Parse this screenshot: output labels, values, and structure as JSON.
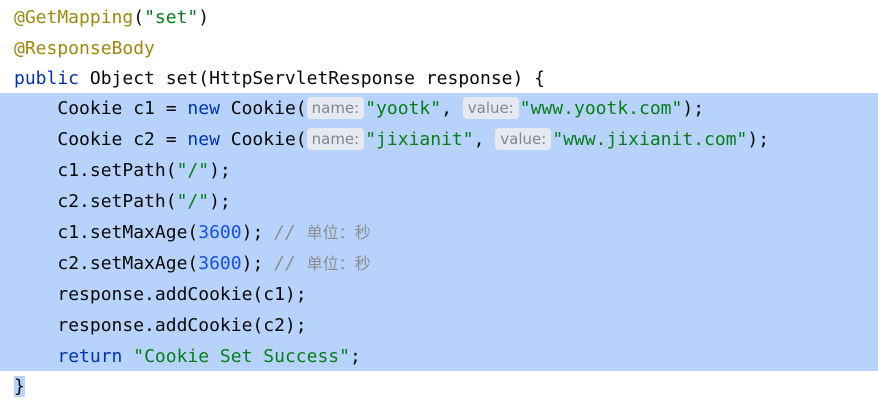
{
  "code": {
    "l1": {
      "ann": "@GetMapping",
      "p1": "(",
      "str": "\"set\"",
      "p2": ")"
    },
    "l2": {
      "ann": "@ResponseBody"
    },
    "l3": {
      "kw": "public",
      "rest": " Object set(HttpServletResponse response) {"
    },
    "l4": {
      "indent": "    ",
      "t1": "Cookie c1 = ",
      "kw": "new",
      "t2": " Cookie(",
      "hint1": "name:",
      "str1": "\"yootk\"",
      "sep": ", ",
      "hint2": "value:",
      "str2": "\"www.yootk.com\"",
      "end": ");"
    },
    "l5": {
      "indent": "    ",
      "t1": "Cookie c2 = ",
      "kw": "new",
      "t2": " Cookie(",
      "hint1": "name:",
      "str1": "\"jixianit\"",
      "sep": ", ",
      "hint2": "value:",
      "str2": "\"www.jixianit.com\"",
      "end": ");"
    },
    "l6": {
      "indent": "    ",
      "t1": "c1.setPath(",
      "str": "\"/\"",
      "end": ");"
    },
    "l7": {
      "indent": "    ",
      "t1": "c2.setPath(",
      "str": "\"/\"",
      "end": ");"
    },
    "l8": {
      "indent": "    ",
      "t1": "c1.setMaxAge(",
      "num": "3600",
      "end": "); ",
      "cmt": "// ",
      "cjk": "单位：秒"
    },
    "l9": {
      "indent": "    ",
      "t1": "c2.setMaxAge(",
      "num": "3600",
      "end": "); ",
      "cmt": "// ",
      "cjk": "单位：秒"
    },
    "l10": {
      "indent": "    ",
      "t1": "response.addCookie(c1);"
    },
    "l11": {
      "indent": "    ",
      "t1": "response.addCookie(c2);"
    },
    "l12": {
      "indent": "    ",
      "kw": "return",
      "sp": " ",
      "str": "\"Cookie Set Success\"",
      "end": ";"
    },
    "l13": {
      "t1": "}"
    }
  },
  "colors": {
    "selection": "#b7d3fb",
    "annotation": "#9e880d",
    "keyword": "#0033b3",
    "string": "#067d17",
    "number": "#1750eb",
    "comment": "#8c8c8c"
  }
}
